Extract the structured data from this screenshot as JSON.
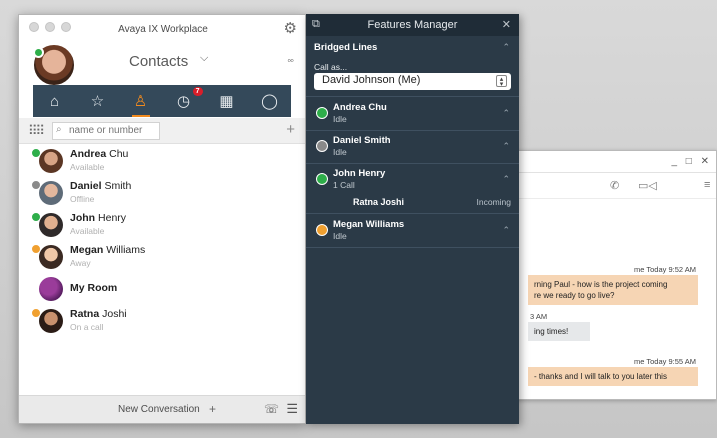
{
  "chat_window": {
    "window_buttons": "_ □ ✕",
    "messages": [
      {
        "stamp": "me  Today 9:52 AM",
        "text_line1": "rning Paul - how is the project coming",
        "text_line2": "re we ready to go live?",
        "kind": "out"
      },
      {
        "stamp": "3 AM",
        "text_line1": "ing times!",
        "kind": "in"
      },
      {
        "stamp": "me  Today 9:55 AM",
        "text_line1": "- thanks and I will talk to you later this",
        "kind": "out"
      }
    ]
  },
  "main": {
    "app_title": "Avaya IX Workplace",
    "header_title": "Contacts",
    "nav": {
      "badge_count": "7",
      "active_tab": "contacts"
    },
    "search": {
      "placeholder": "name or number"
    },
    "contacts": [
      {
        "first": "Andrea",
        "last": "Chu",
        "status": "Available",
        "status_color": "#2eae4a"
      },
      {
        "first": "Daniel",
        "last": "Smith",
        "status": "Offline",
        "status_color": "#8a8a8a"
      },
      {
        "first": "John",
        "last": "Henry",
        "status": "Available",
        "status_color": "#2eae4a"
      },
      {
        "first": "Megan",
        "last": "Williams",
        "status": "Away",
        "status_color": "#f0a030"
      },
      {
        "first": "Ratna",
        "last": "Joshi",
        "status": "On a call",
        "status_color": "#f0a030"
      }
    ],
    "room_name": "My Room",
    "bottom": {
      "new_conversation": "New Conversation"
    }
  },
  "features": {
    "title": "Features Manager",
    "section_title": "Bridged Lines",
    "call_as_label": "Call as...",
    "call_as_value": "David Johnson (Me)",
    "lines": [
      {
        "name": "Andrea Chu",
        "status": "Idle",
        "color": "#2eae4a"
      },
      {
        "name": "Daniel Smith",
        "status": "Idle",
        "color": "#8a8a8a"
      },
      {
        "name": "John Henry",
        "status": "1 Call",
        "color": "#2eae4a"
      },
      {
        "name": "Megan Williams",
        "status": "Idle",
        "color": "#f0a030"
      }
    ],
    "sub_call": {
      "who": "Ratna Joshi",
      "state": "Incoming"
    }
  },
  "colors": {
    "accent": "#f18a1e",
    "nav_bg": "#34495a",
    "features_bg": "#2b3a47",
    "badge": "#d91e2a"
  }
}
